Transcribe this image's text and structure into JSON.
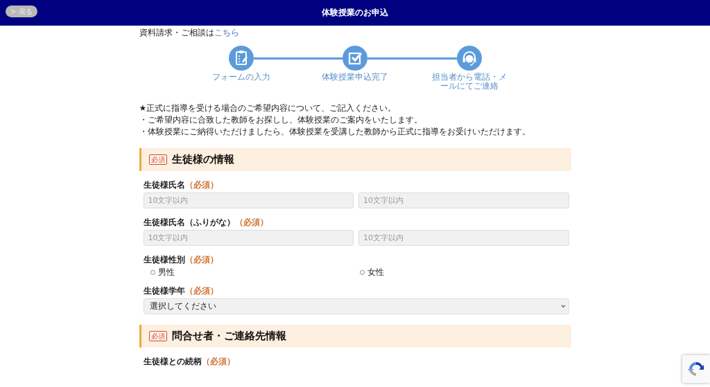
{
  "header": {
    "back_button": "> 戻る",
    "title": "体験授業のお申込"
  },
  "intro": {
    "text": "資料請求・ご相談は",
    "link": "こちら"
  },
  "steps": [
    {
      "label": "フォームの入力",
      "kind": "clipboard"
    },
    {
      "label": "体験授業申込完了",
      "kind": "check"
    },
    {
      "label": "担当者から電話・メールにてご連絡",
      "kind": "headset"
    }
  ],
  "notes": [
    "★正式に指導を受ける場合のご希望内容について、ご記入ください。",
    "・ご希望内容に合致した教師をお探しし、体験授業のご案内をいたします。",
    "・体験授業にご納得いただけましたら、体験授業を受講した教師から正式に指導をお受けいただけます。"
  ],
  "sections": [
    {
      "badge": "必須",
      "title": "生徒様の情報",
      "fields": [
        {
          "label": "生徒様氏名",
          "required": "（必須）",
          "kind": "text-pair",
          "placeholders": [
            "10文字以内",
            "10文字以内"
          ]
        },
        {
          "label": "生徒様氏名（ふりがな）",
          "required": "（必須）",
          "kind": "text-pair",
          "placeholders": [
            "10文字以内",
            "10文字以内"
          ]
        },
        {
          "label": "生徒様性別",
          "required": "（必須）",
          "kind": "radio",
          "options": [
            {
              "label": "男性",
              "selected": false
            },
            {
              "label": "女性",
              "selected": false
            }
          ]
        },
        {
          "label": "生徒様学年",
          "required": "（必須）",
          "kind": "select",
          "value": "選択してください"
        }
      ]
    },
    {
      "badge": "必須",
      "title": "問合せ者・ご連絡先情報",
      "fields": [
        {
          "label": "生徒様との続柄",
          "required": "（必須）",
          "kind": "label-only"
        }
      ]
    }
  ]
}
